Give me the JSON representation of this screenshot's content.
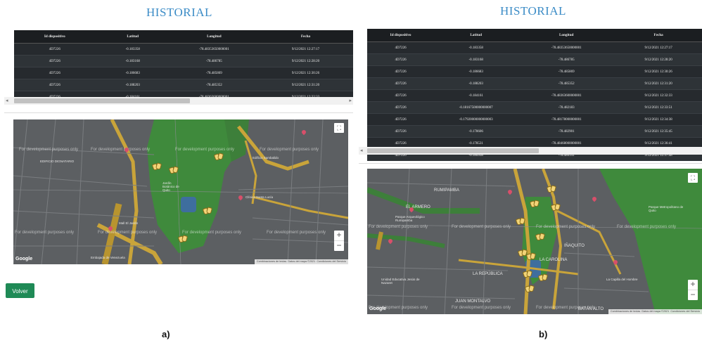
{
  "panel_a": {
    "title": "HISTORIAL",
    "columns": [
      "Id dispositivo",
      "Latitud",
      "Longitud",
      "Fecha"
    ],
    "rows": [
      [
        "4D7226",
        "-0.183358",
        "-78.48353650000001",
        "9/12/2021 12:27:17"
      ],
      [
        "4D7226",
        "-0.183168",
        "-78.486785",
        "9/12/2021 12:28:20"
      ],
      [
        "4D7226",
        "-0.186683",
        "-78.485869",
        "9/12/2021 12:30:26"
      ],
      [
        "4D7226",
        "-0.188203",
        "-78.485352",
        "9/12/2021 12:31:20"
      ],
      [
        "4D7226",
        "-0.184161",
        "-78.48363600000001",
        "9/12/2021 12:32:33"
      ]
    ],
    "scroll_left": "◂",
    "scroll_right": "▸",
    "map": {
      "dev_text": "For development purposes only",
      "labels": [
        "EDIFICIO DIGNATARIO",
        "Jardín Botánico de Quito",
        "Mall El Jardín",
        "Clínica Santa Lucía",
        "Edificio Sambalido",
        "Embajada de Venezuela"
      ],
      "fullscreen_icon": "⛶",
      "zoom_in": "+",
      "zoom_out": "−",
      "google": "Google",
      "footer": [
        "Combinaciones de teclas",
        "Datos del mapa ©2021",
        "Condiciones del Servicio"
      ]
    },
    "button_volver": "Volver",
    "caption": "a)"
  },
  "panel_b": {
    "title": "HISTORIAL",
    "columns": [
      "Id dispositivo",
      "Latitud",
      "Longitud",
      "Fecha"
    ],
    "rows": [
      [
        "4D7226",
        "-0.183358",
        "-78.48353650000001",
        "9/12/2021 12:27:17"
      ],
      [
        "4D7226",
        "-0.183168",
        "-78.486785",
        "9/12/2021 12:28:20"
      ],
      [
        "4D7226",
        "-0.186683",
        "-78.485869",
        "9/12/2021 12:30:26"
      ],
      [
        "4D7226",
        "-0.188203",
        "-78.485352",
        "9/12/2021 12:31:20"
      ],
      [
        "4D7226",
        "-0.184161",
        "-78.48363600000001",
        "9/12/2021 12:32:33"
      ],
      [
        "4D7226",
        "-0.18167500000000007",
        "-78.482183",
        "9/12/2021 12:33:51"
      ],
      [
        "4D7226",
        "-0.17920000000000003",
        "-78.48178000000001",
        "9/12/2021 12:34:38"
      ],
      [
        "4D7226",
        "-0.178606",
        "-78.482901",
        "9/12/2021 12:35:45"
      ],
      [
        "4D7226",
        "-0.178531",
        "-78.48468000000001",
        "9/12/2021 12:36:41"
      ],
      [
        "4D7226",
        "-0.180938",
        "-78.486141",
        "9/12/2021 12:37:48"
      ]
    ],
    "scroll_left": "◂",
    "map": {
      "dev_text": "For development purposes only",
      "labels": [
        "RUMIPAMBA",
        "EL ARMERO",
        "IÑAQUITO",
        "LA CAROLINA",
        "LA REPÚBLICA",
        "JUAN MONTALVO",
        "BATÁN ALTO",
        "Parque Arqueológico Rumipamba",
        "Parque Metropolitano de Quito",
        "Unidad Educativa Jesús de Nazaret",
        "La Capilla del Hombre"
      ],
      "fullscreen_icon": "⛶",
      "zoom_in": "+",
      "zoom_out": "−",
      "google": "Google",
      "footer": [
        "Combinaciones de teclas",
        "Datos del mapa ©2021",
        "Condiciones del Servicio"
      ]
    },
    "caption": "b)"
  }
}
